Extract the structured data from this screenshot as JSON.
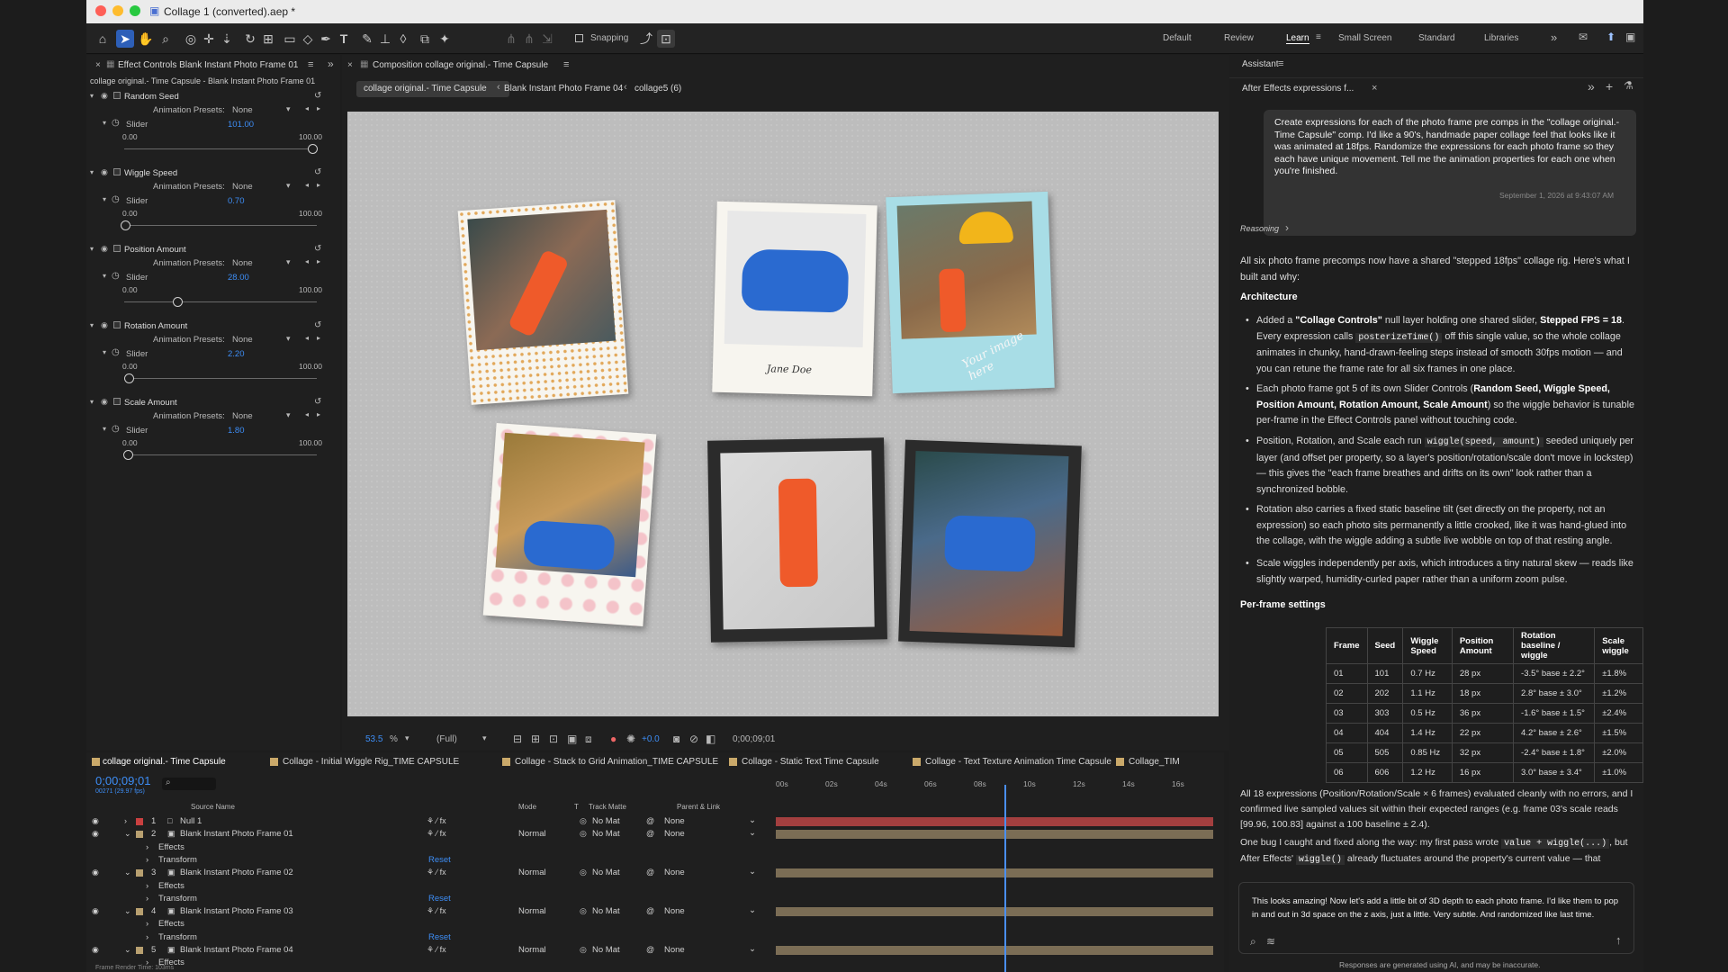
{
  "window": {
    "title": "Collage 1 (converted).aep *"
  },
  "toolbar": {
    "snapping_label": "Snapping",
    "workspaces": [
      "Default",
      "Review",
      "Learn",
      "Small Screen",
      "Standard",
      "Libraries"
    ]
  },
  "effect_controls": {
    "tab": "Effect Controls Blank Instant Photo Frame 01",
    "subtitle": "collage original.- Time Capsule - Blank Instant Photo Frame 01",
    "anim_label": "Animation Presets:",
    "preset": "None",
    "slider_label": "Slider",
    "min": "0.00",
    "max": "100.00",
    "effects": [
      {
        "name": "Random Seed",
        "value": "101.00",
        "level": 1.0
      },
      {
        "name": "Wiggle Speed",
        "value": "0.70",
        "level": 0.007
      },
      {
        "name": "Position Amount",
        "value": "28.00",
        "level": 0.28
      },
      {
        "name": "Rotation Amount",
        "value": "2.20",
        "level": 0.022
      },
      {
        "name": "Scale Amount",
        "value": "1.80",
        "level": 0.018
      }
    ]
  },
  "composition": {
    "tab": "Composition collage original.- Time Capsule",
    "crumbs": [
      "collage original.- Time Capsule",
      "Blank Instant Photo Frame 04",
      "collage5 (6)"
    ],
    "zoom": "53.5",
    "resolution": "(Full)",
    "exposure": "+0.0",
    "timecode": "0;00;09;01",
    "caption_card": "Jane Doe",
    "caption_script": "Your image here"
  },
  "timeline": {
    "tabs": [
      "collage original.- Time Capsule",
      "Collage - Initial Wiggle Rig_TIME CAPSULE",
      "Collage - Stack to Grid Animation_TIME CAPSULE",
      "Collage - Static Text Time Capsule",
      "Collage - Text Texture Animation Time Capsule",
      "Collage_TIM"
    ],
    "timecode": "0;00;09;01",
    "fps": "00271 (29.97 fps)",
    "cols": [
      "Source Name",
      "Mode",
      "T",
      "Track Matte",
      "Parent & Link"
    ],
    "ruler": [
      "00s",
      "02s",
      "04s",
      "06s",
      "08s",
      "10s",
      "12s",
      "14s",
      "16s"
    ],
    "layers": [
      {
        "num": "1",
        "name": "Null 1",
        "mode": "",
        "matte": "No Mat",
        "parent": "None",
        "color": "#c94040"
      },
      {
        "num": "2",
        "name": "Blank Instant Photo Frame 01",
        "mode": "Normal",
        "matte": "No Mat",
        "parent": "None",
        "color": "#b8a070"
      },
      {
        "num": "3",
        "name": "Blank Instant Photo Frame 02",
        "mode": "Normal",
        "matte": "No Mat",
        "parent": "None",
        "color": "#b8a070"
      },
      {
        "num": "4",
        "name": "Blank Instant Photo Frame 03",
        "mode": "Normal",
        "matte": "No Mat",
        "parent": "None",
        "color": "#b8a070"
      },
      {
        "num": "5",
        "name": "Blank Instant Photo Frame 04",
        "mode": "Normal",
        "matte": "No Mat",
        "parent": "None",
        "color": "#b8a070"
      }
    ],
    "effects_label": "Effects",
    "transform_label": "Transform",
    "reset_label": "Reset",
    "render_time": "Frame Render Time: 103ms"
  },
  "assistant": {
    "panel": "Assistant",
    "tab": "After Effects expressions f...",
    "user_msg": "Create expressions for each of the photo frame pre comps in the \"collage original.- Time Capsule\" comp. I'd like a 90's, handmade paper collage feel that looks like it was animated at 18fps. Randomize the expressions for each photo frame so they each have unique movement. Tell me the animation properties for each one when you're finished.",
    "timestamp": "September 1, 2026 at 9:43:07 AM",
    "reasoning": "Reasoning",
    "intro": "All six photo frame precomps now have a shared \"stepped 18fps\" collage rig. Here's what I built and why:",
    "h_arch": "Architecture",
    "b1a": "Added a ",
    "b1b": "\"Collage Controls\"",
    "b1c": " null layer holding one shared slider, ",
    "b1d": "Stepped FPS = 18",
    "b1e": ". Every expression calls ",
    "b1f": "posterizeTime()",
    "b1g": " off this single value, so the whole collage animates in chunky, hand-drawn-feeling steps instead of smooth 30fps motion — and you can retune the frame rate for all six frames in one place.",
    "b2a": "Each photo frame got 5 of its own Slider Controls (",
    "b2b": "Random Seed, Wiggle Speed, Position Amount, Rotation Amount, Scale Amount",
    "b2c": ") so the wiggle behavior is tunable per-frame in the Effect Controls panel without touching code.",
    "b3a": "Position, Rotation, and Scale each run ",
    "b3b": "wiggle(speed, amount)",
    "b3c": " seeded uniquely per layer (and offset per property, so a layer's position/rotation/scale don't move in lockstep) — this gives the \"each frame breathes and drifts on its own\" look rather than a synchronized bobble.",
    "b4": "Rotation also carries a fixed static baseline tilt (set directly on the property, not an expression) so each photo sits permanently a little crooked, like it was hand-glued into the collage, with the wiggle adding a subtle live wobble on top of that resting angle.",
    "b5": "Scale wiggles independently per axis, which introduces a tiny natural skew — reads like slightly warped, humidity-curled paper rather than a uniform zoom pulse.",
    "h_pf": "Per-frame settings",
    "table_head": [
      "Frame",
      "Seed",
      "Wiggle Speed",
      "Position Amount",
      "Rotation baseline / wiggle",
      "Scale wiggle"
    ],
    "table_rows": [
      [
        "01",
        "101",
        "0.7 Hz",
        "28 px",
        "-3.5° base ± 2.2°",
        "±1.8%"
      ],
      [
        "02",
        "202",
        "1.1 Hz",
        "18 px",
        "2.8° base ± 3.0°",
        "±1.2%"
      ],
      [
        "03",
        "303",
        "0.5 Hz",
        "36 px",
        "-1.6° base ± 1.5°",
        "±2.4%"
      ],
      [
        "04",
        "404",
        "1.4 Hz",
        "22 px",
        "4.2° base ± 2.6°",
        "±1.5%"
      ],
      [
        "05",
        "505",
        "0.85 Hz",
        "32 px",
        "-2.4° base ± 1.8°",
        "±2.0%"
      ],
      [
        "06",
        "606",
        "1.2 Hz",
        "16 px",
        "3.0° base ± 3.4°",
        "±1.0%"
      ]
    ],
    "after_table": "All 18 expressions (Position/Rotation/Scale × 6 frames) evaluated cleanly with no errors, and I confirmed live sampled values sit within their expected ranges (e.g. frame 03's scale reads [99.96, 100.83] against a 100 baseline ± 2.4).",
    "bug_a": "One bug I caught and fixed along the way: my first pass wrote ",
    "bug_b": "value + wiggle(...)",
    "bug_c": ", but After Effects' ",
    "bug_d": "wiggle()",
    "bug_e": " already fluctuates around the property's current value — that",
    "input": "This looks amazing! Now let's add a little bit of 3D depth to each photo frame. I'd like them to pop in and out in 3d space on the z axis, just a little. Very subtle. And randomized like last time.",
    "disclaimer": "Responses are generated using AI, and may be inaccurate."
  }
}
